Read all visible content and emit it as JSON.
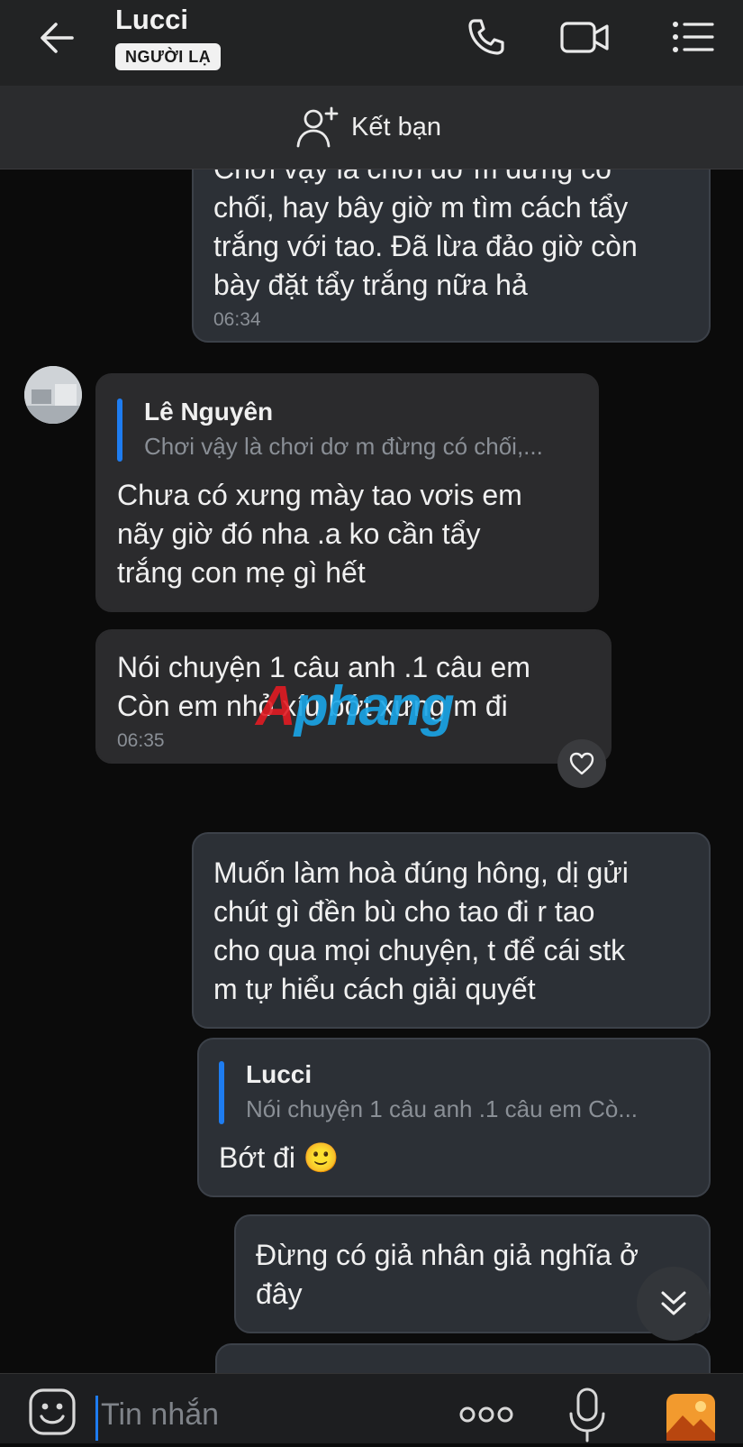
{
  "header": {
    "contact_name": "Lucci",
    "badge": "NGƯỜI LẠ",
    "icons": [
      "arrow-left-icon",
      "phone-icon",
      "video-call-icon",
      "menu-list-icon"
    ]
  },
  "add_friend": {
    "label": "Kết bạn",
    "icon": "add-user-icon"
  },
  "messages": [
    {
      "direction": "out",
      "text": "Chơi vậy là chơi dơ m đừng có\nchối, hay bây giờ m tìm cách tẩy\ntrắng với tao. Đã lừa đảo giờ còn\nbày đặt tẩy trắng nữa hả",
      "time": "06:34"
    },
    {
      "direction": "in",
      "quote": {
        "name": "Lê Nguyên",
        "text": "Chơi vậy là chơi dơ m đừng có chối,..."
      },
      "text": "Chưa có xưng mày tao vơis em\nnãy giờ đó nha .a ko cần tẩy\ntrắng con mẹ gì hết"
    },
    {
      "direction": "in",
      "text": "Nói chuyện 1 câu anh .1 câu em\nCòn em nhỏ xíu bớt xưng m đi",
      "time": "06:35"
    },
    {
      "direction": "out",
      "text": "Muốn làm hoà đúng hông, dị gửi\nchút gì đền bù cho tao đi r tao\ncho qua mọi chuyện, t để cái stk\nm tự hiểu cách giải quyết"
    },
    {
      "direction": "out",
      "quote": {
        "name": "Lucci",
        "text": "Nói chuyện 1 câu anh .1 câu em  Cò..."
      },
      "text": "Bớt đi 🙂"
    },
    {
      "direction": "out",
      "text": "Đừng có giả nhân giả nghĩa ở\nđây"
    }
  ],
  "watermark": {
    "part1": "A",
    "part2": "phang"
  },
  "input": {
    "placeholder": "Tin nhắn",
    "icons": [
      "emoji-icon",
      "more-options-icon",
      "microphone-icon",
      "image-icon"
    ]
  },
  "colors": {
    "accent": "#1e7cf0",
    "bubble_out": "#2c3036",
    "bubble_in": "#2b2b2d",
    "background": "#0b0b0b"
  }
}
